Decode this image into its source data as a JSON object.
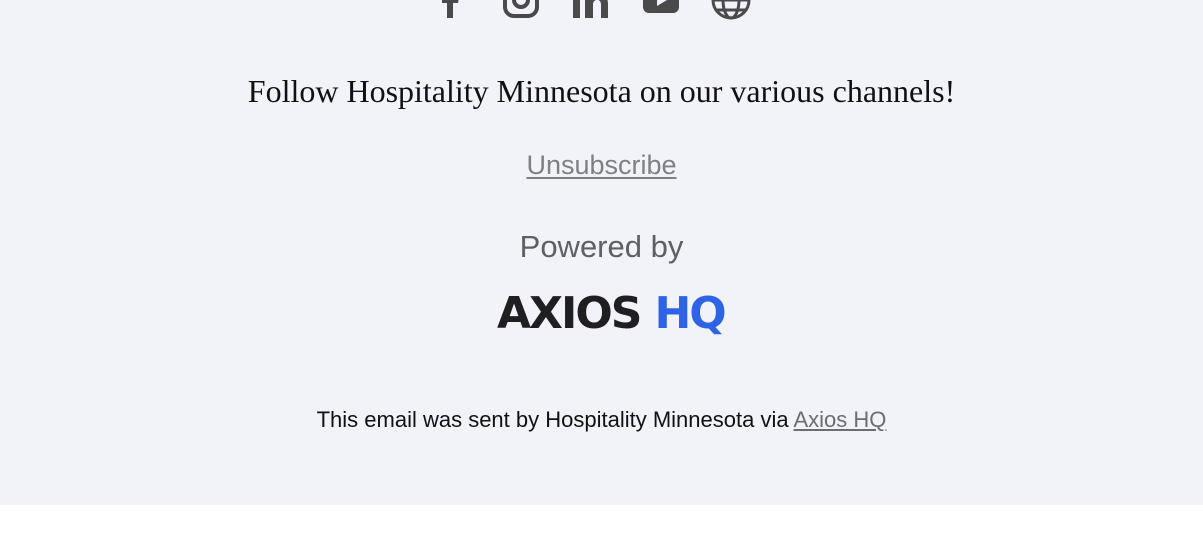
{
  "footer": {
    "background_color": "#f2f3f8",
    "social_icons": [
      {
        "name": "facebook-icon"
      },
      {
        "name": "instagram-icon"
      },
      {
        "name": "linkedin-icon"
      },
      {
        "name": "youtube-icon"
      },
      {
        "name": "globe-icon"
      }
    ],
    "follow_text": "Follow Hospitality Minnesota on our various channels!",
    "unsubscribe_label": "Unsubscribe",
    "powered_by_label": "Powered by",
    "brand": {
      "part1": "AXIOS",
      "part2": "HQ",
      "colors": {
        "part1": "#1f1f22",
        "part2": "#2f63e6"
      }
    },
    "sent_by": {
      "prefix": "This email was sent by Hospitality Minnesota via",
      "link_label": "Axios HQ"
    }
  }
}
